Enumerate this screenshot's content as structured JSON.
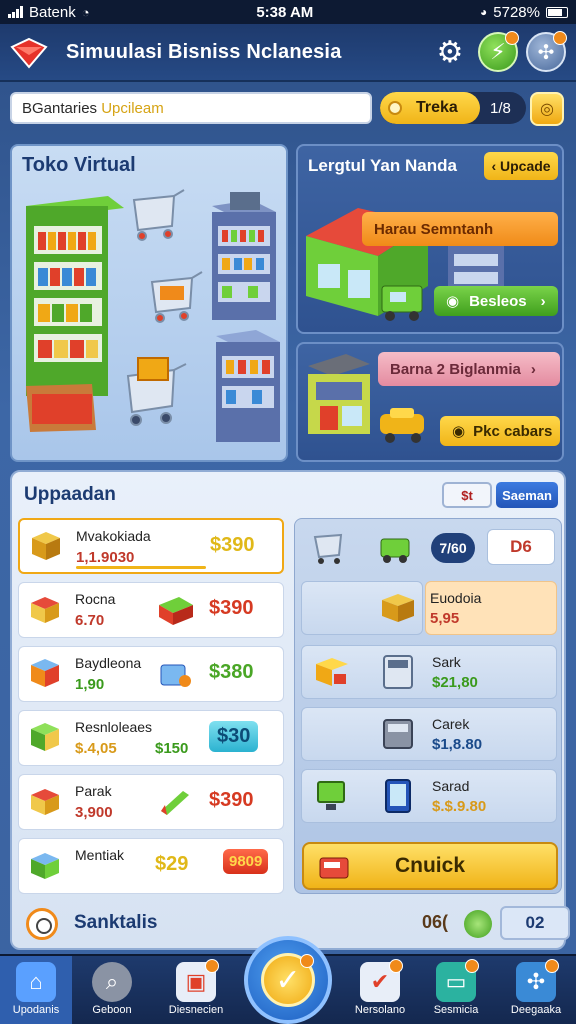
{
  "status_bar": {
    "carrier": "Batenk",
    "time": "5:38 AM",
    "battery": "5728%"
  },
  "header": {
    "title": "Simuulasi Bisniss Nclanesia"
  },
  "search": {
    "prefix": "BGantaries",
    "highlight": "Upcileam"
  },
  "currency": {
    "label": "Treka",
    "count": "1/8"
  },
  "toko": {
    "title": "Toko Virtual"
  },
  "right_panel": {
    "title": "Lergtul Yan Nanda",
    "upcade_label": "‹ Upcade",
    "tag_a": "Harau Semntanh",
    "tag_b": "Besleos",
    "tag_c": "Barna 2 Biglanmia",
    "tag_d": "Pkc cabars"
  },
  "upgrade": {
    "title": "Uppaadan",
    "btn_small": "$t",
    "btn_blue": "Saeman",
    "left_items": [
      {
        "name": "Mvakokiada",
        "price": "1,1.9030",
        "badge": "$390"
      },
      {
        "name": "Rocna",
        "price": "6.70",
        "badge": "$390"
      },
      {
        "name": "Baydleona",
        "price": "1,90",
        "badge": "$380"
      },
      {
        "name": "Resnloleaes",
        "price": "$.4,05",
        "mid": "$150",
        "badge": "$30"
      },
      {
        "name": "Parak",
        "price": "3,900",
        "badge": "$390"
      },
      {
        "name": "Mentiak",
        "price": "",
        "mid": "$29",
        "badge": "9809"
      }
    ],
    "right_items": [
      {
        "chip": "7/60",
        "value": "D6"
      },
      {
        "name": "Euodoia",
        "price": "5,95"
      },
      {
        "name": "Sark",
        "price": "$21,80"
      },
      {
        "name": "Carek",
        "price": "$1,8.80"
      },
      {
        "name": "Sarad",
        "price": "$.$.9.80"
      }
    ],
    "action_button": "Cnuick",
    "footer_label": "Sanktalis",
    "footer_value": "06(",
    "footer_pill": "02"
  },
  "nav": [
    {
      "label": "Upodanis",
      "icon": "home-icon"
    },
    {
      "label": "Geboon",
      "icon": "search-icon"
    },
    {
      "label": "Diesnecien",
      "icon": "market-icon"
    },
    {
      "label": "",
      "icon": "check-icon"
    },
    {
      "label": "Nersolano",
      "icon": "chart-icon"
    },
    {
      "label": "Sesmicia",
      "icon": "register-icon"
    },
    {
      "label": "Deegaaka",
      "icon": "puzzle-icon"
    }
  ],
  "colors": {
    "accent": "#f0b418",
    "panel": "#3e64a3",
    "nav": "#1e3a6d"
  }
}
